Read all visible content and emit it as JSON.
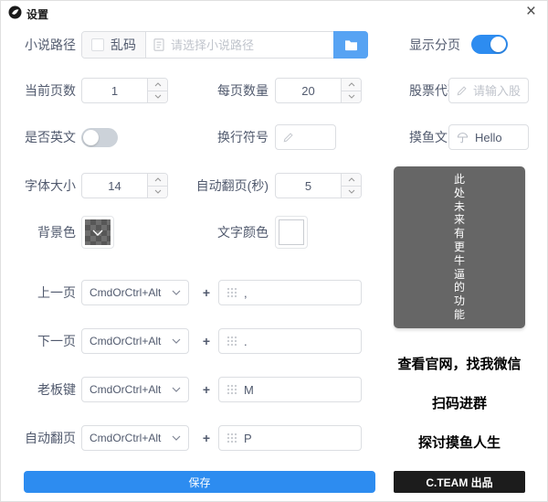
{
  "window": {
    "title": "设置"
  },
  "icons": {
    "close": "×",
    "plus": "+",
    "app_logo": "dark-circle-fish-logo",
    "folder": "white-folder",
    "document": "document-outline",
    "edit": "pencil-outline",
    "moyu": "umbrella-outline",
    "keypad": "dot-grid",
    "chevron_down": "chevron-down"
  },
  "colors": {
    "primary": "#2d8cf0",
    "folder_button": "#57a3f3",
    "toggle_off": "#ccd2d9",
    "future_box_bg": "#666666",
    "team_bar_bg": "#1c1c1c"
  },
  "form": {
    "novel_path": {
      "label": "小说路径",
      "garbled_label": "乱码",
      "garbled_checked": false,
      "placeholder": "请选择小说路径",
      "value": ""
    },
    "show_pagination": {
      "label": "显示分页",
      "on": true
    },
    "current_page": {
      "label": "当前页数",
      "value": "1"
    },
    "page_size": {
      "label": "每页数量",
      "value": "20"
    },
    "stock_code": {
      "label": "股票代码",
      "placeholder": "请输入股票代码",
      "value": ""
    },
    "is_english": {
      "label": "是否英文",
      "on": false
    },
    "line_break": {
      "label": "换行符号",
      "value": ""
    },
    "moyu_text": {
      "label": "摸鱼文字",
      "value": "Hello"
    },
    "font_size": {
      "label": "字体大小",
      "value": "14"
    },
    "auto_flip_seconds": {
      "label": "自动翻页(秒)",
      "value": "5"
    },
    "background_color": {
      "label": "背景色",
      "swatch": "transparent-checker"
    },
    "text_color": {
      "label": "文字颜色",
      "swatch": "#ffffff"
    },
    "shortcuts": [
      {
        "label": "上一页",
        "modifier": "CmdOrCtrl+Alt",
        "key": ","
      },
      {
        "label": "下一页",
        "modifier": "CmdOrCtrl+Alt",
        "key": "."
      },
      {
        "label": "老板键",
        "modifier": "CmdOrCtrl+Alt",
        "key": "M"
      },
      {
        "label": "自动翻页",
        "modifier": "CmdOrCtrl+Alt",
        "key": "P"
      }
    ],
    "save_label": "保存"
  },
  "promo": {
    "future_text": "此处未来有更牛逼的功能",
    "lines": [
      "查看官网，找我微信",
      "扫码进群",
      "探讨摸鱼人生"
    ],
    "team_label": "C.TEAM 出品"
  }
}
